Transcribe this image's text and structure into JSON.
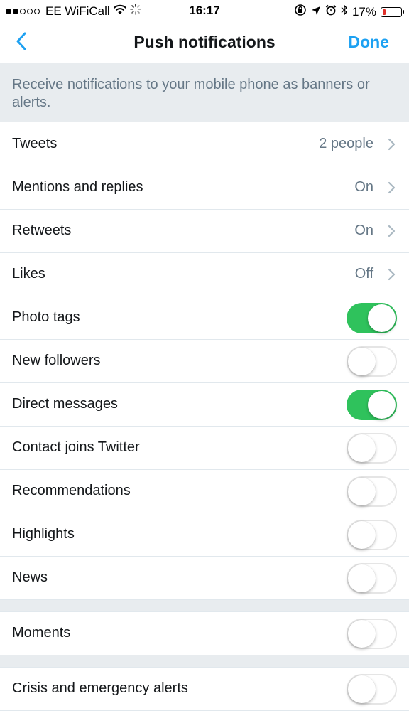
{
  "status_bar": {
    "carrier": "EE WiFiCall",
    "time": "16:17",
    "battery_percent": "17%",
    "battery_level": 0.17,
    "signal_bars": 2,
    "signal_total": 5,
    "icons": [
      "wifi-icon",
      "spinner-icon",
      "rotation-lock-icon",
      "location-arrow-icon",
      "alarm-icon",
      "bluetooth-icon",
      "battery-icon"
    ]
  },
  "nav": {
    "back_icon": "chevron-left-icon",
    "title": "Push notifications",
    "done_label": "Done"
  },
  "description": "Receive notifications to your mobile phone as banners or alerts.",
  "rows": [
    {
      "label": "Tweets",
      "value": "2 people",
      "type": "link"
    },
    {
      "label": "Mentions and replies",
      "value": "On",
      "type": "link"
    },
    {
      "label": "Retweets",
      "value": "On",
      "type": "link"
    },
    {
      "label": "Likes",
      "value": "Off",
      "type": "link"
    },
    {
      "label": "Photo tags",
      "on": true,
      "type": "toggle"
    },
    {
      "label": "New followers",
      "on": false,
      "type": "toggle"
    },
    {
      "label": "Direct messages",
      "on": true,
      "type": "toggle"
    },
    {
      "label": "Contact joins Twitter",
      "on": false,
      "type": "toggle"
    },
    {
      "label": "Recommendations",
      "on": false,
      "type": "toggle"
    },
    {
      "label": "Highlights",
      "on": false,
      "type": "toggle"
    },
    {
      "label": "News",
      "on": false,
      "type": "toggle"
    }
  ],
  "moments_row": {
    "label": "Moments",
    "on": false,
    "type": "toggle"
  },
  "crisis_row": {
    "label": "Crisis and emergency alerts",
    "on": false,
    "type": "toggle"
  },
  "colors": {
    "accent": "#1da1f2",
    "toggle_on": "#2fc25c",
    "secondary_text": "#657786",
    "section_bg": "#e8ecef",
    "battery_low": "#e0302a"
  }
}
